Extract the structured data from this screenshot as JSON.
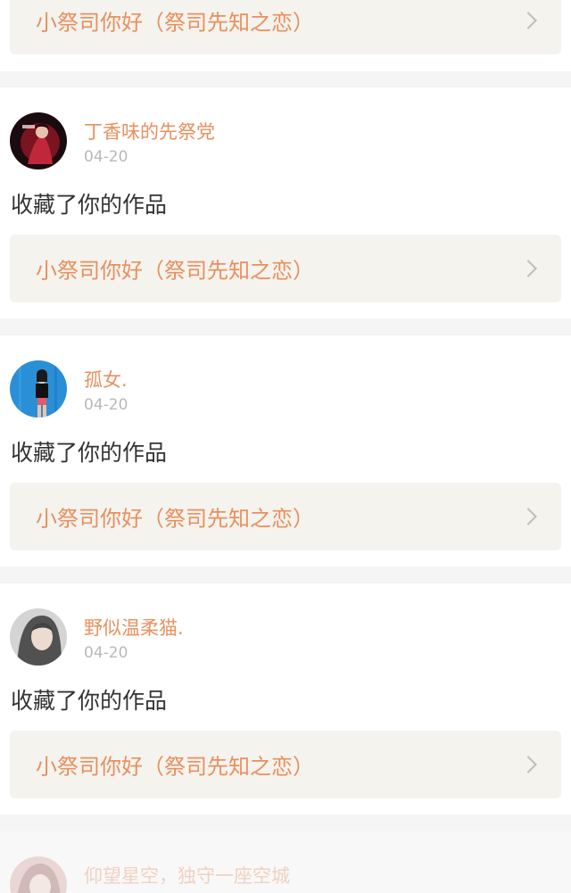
{
  "feed": [
    {
      "work_title": "小祭司你好（祭司先知之恋）"
    },
    {
      "username": "丁香味的先祭党",
      "date": "04-20",
      "action": "收藏了你的作品",
      "work_title": "小祭司你好（祭司先知之恋）"
    },
    {
      "username": "孤女.",
      "date": "04-20",
      "action": "收藏了你的作品",
      "work_title": "小祭司你好（祭司先知之恋）"
    },
    {
      "username": "野似温柔猫.",
      "date": "04-20",
      "action": "收藏了你的作品",
      "work_title": "小祭司你好（祭司先知之恋）"
    },
    {
      "username": "仰望星空，独守一座空城"
    }
  ],
  "colors": {
    "accent": "#e8905f",
    "background": "#f5f5f5",
    "card": "#ffffff",
    "work_box": "#f4f3ee",
    "text": "#333333",
    "muted": "#b9b9b9"
  }
}
